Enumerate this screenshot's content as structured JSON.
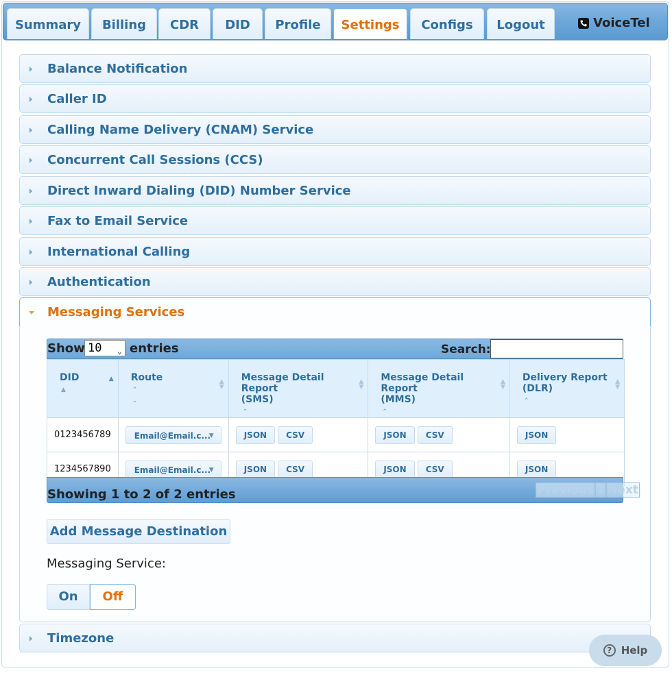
{
  "nav": {
    "tabs": [
      {
        "label": "Summary"
      },
      {
        "label": "Billing"
      },
      {
        "label": "CDR"
      },
      {
        "label": "DID"
      },
      {
        "label": "Profile"
      },
      {
        "label": "Settings",
        "active": true
      },
      {
        "label": "Configs"
      },
      {
        "label": "Logout"
      }
    ],
    "brand": "VoiceTel"
  },
  "sections": [
    {
      "label": "Balance Notification"
    },
    {
      "label": "Caller ID"
    },
    {
      "label": "Calling Name Delivery (CNAM) Service"
    },
    {
      "label": "Concurrent Call Sessions (CCS)"
    },
    {
      "label": "Direct Inward Dialing (DID) Number Service"
    },
    {
      "label": "Fax to Email Service"
    },
    {
      "label": "International Calling"
    },
    {
      "label": "Authentication"
    },
    {
      "label": "Messaging Services",
      "open": true
    },
    {
      "label": "Timezone"
    }
  ],
  "messaging": {
    "table": {
      "show_label": "Show",
      "page_size": "10",
      "entries_label": "entries",
      "search_label": "Search:",
      "search_value": "",
      "columns": [
        {
          "line1": "DID",
          "line2": ""
        },
        {
          "line1": "Route",
          "line2": ""
        },
        {
          "line1": "Message Detail Report",
          "line2": "(SMS)"
        },
        {
          "line1": "Message Detail Report",
          "line2": "(MMS)"
        },
        {
          "line1": "Delivery Report",
          "line2": "(DLR)"
        }
      ],
      "rows": [
        {
          "did": "0123456789",
          "route": "Email@Email.c...",
          "sms": [
            "JSON",
            "CSV"
          ],
          "mms": [
            "JSON",
            "CSV"
          ],
          "dlr": [
            "JSON"
          ]
        },
        {
          "did": "1234567890",
          "route": "Email@Email.c...",
          "sms": [
            "JSON",
            "CSV"
          ],
          "mms": [
            "JSON",
            "CSV"
          ],
          "dlr": [
            "JSON"
          ]
        }
      ],
      "info": "Showing 1 to 2 of 2 entries",
      "pager": {
        "previous": "Previous",
        "page": "1",
        "next": "Next"
      }
    },
    "add_button": "Add Message Destination",
    "service_label": "Messaging Service:",
    "toggle": {
      "on": "On",
      "off": "Off",
      "selected": "Off"
    }
  },
  "help": {
    "label": "Help"
  },
  "colors": {
    "accent": "#e17009",
    "header_text": "#2e6e9e",
    "bar": "#6fa8d9",
    "border": "#c5dbec"
  }
}
